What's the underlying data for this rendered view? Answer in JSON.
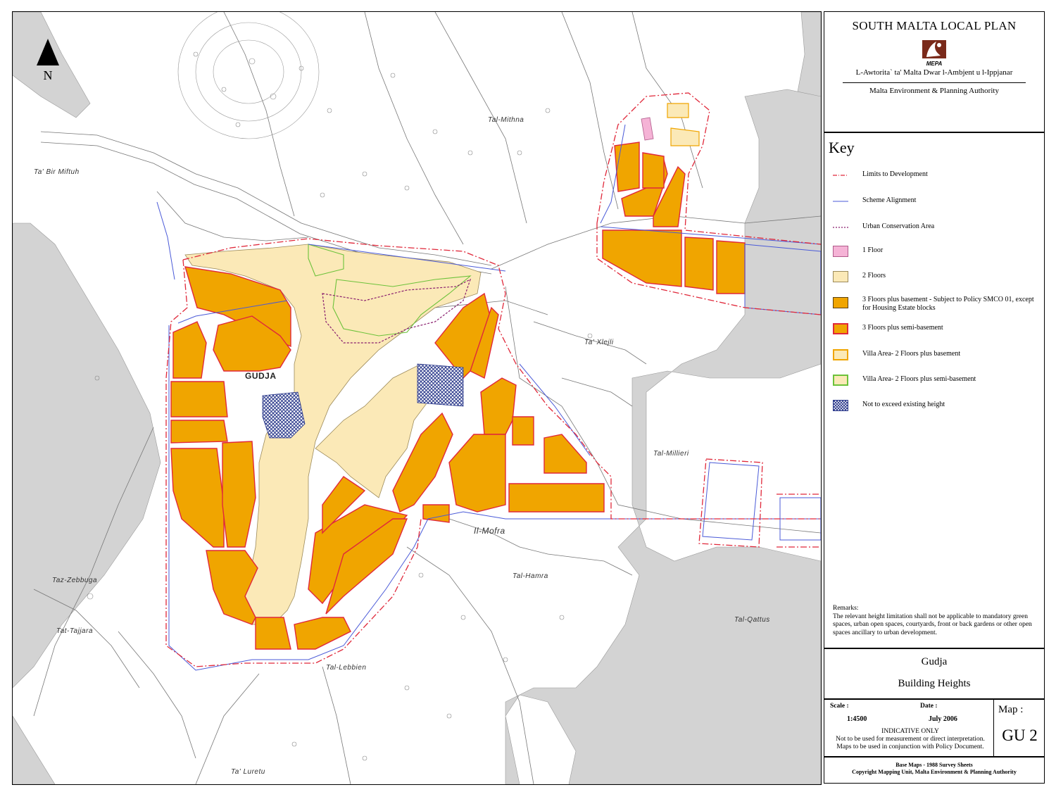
{
  "header": {
    "plan_title": "SOUTH MALTA LOCAL PLAN",
    "logo_text": "MEPA",
    "org_maltese": "L-Awtorita` ta' Malta Dwar l-Ambjent u l-Ippjanar",
    "org_english": "Malta Environment & Planning Authority"
  },
  "north_arrow": {
    "label": "N"
  },
  "place_names": [
    "Ta' Bir Miftuh",
    "Tal-Mithna",
    "Ta' Xlejli",
    "GUDJA",
    "Tal-Millieri",
    "Il-Mofra",
    "Tal-Hamra",
    "Taz-Zebbuga",
    "Tat-Tajjara",
    "Tal-Lebbien",
    "Tal-Qattus",
    "Ta' Luretu"
  ],
  "key": {
    "title": "Key",
    "items": [
      {
        "label": "Limits to Development",
        "kind": "dashdot",
        "color": "#e0283a"
      },
      {
        "label": "Scheme Alignment",
        "kind": "line",
        "color": "#4a5ad8"
      },
      {
        "label": "Urban Conservation Area",
        "kind": "dotted",
        "color": "#8a1f6e"
      },
      {
        "label": "1 Floor",
        "kind": "fill",
        "color": "#f5b3d6",
        "border": "#b05a8a"
      },
      {
        "label": "2 Floors",
        "kind": "fill",
        "color": "#fbe9b7",
        "border": "#9c8a5a"
      },
      {
        "label": "3 Floors plus basement - Subject to Policy SMCO 01, except for Housing Estate blocks",
        "kind": "fill",
        "color": "#f0a500",
        "border": "#5a4010"
      },
      {
        "label": "3 Floors plus semi-basement",
        "kind": "fill",
        "color": "#f0a500",
        "border": "#e0283a"
      },
      {
        "label": "Villa Area- 2 Floors plus basement",
        "kind": "fill",
        "color": "#fbe9b7",
        "border": "#f0a500"
      },
      {
        "label": "Villa Area- 2 Floors plus semi-basement",
        "kind": "fill",
        "color": "#fbe9b7",
        "border": "#6cc23a"
      },
      {
        "label": "Not to exceed existing height",
        "kind": "hatch",
        "color": "#2c3a8c",
        "border": "#2c3a8c"
      }
    ]
  },
  "remarks": {
    "heading": "Remarks:",
    "text": "The relevant height limitation shall not be applicable to mandatory green spaces, urban open spaces, courtyards, front or back gardens or other open spaces ancillary to urban development."
  },
  "map_name": {
    "locality": "Gudja",
    "subject": "Building Heights"
  },
  "info": {
    "scale_label": "Scale :",
    "scale_value": "1:4500",
    "date_label": "Date :",
    "date_value": "July 2006",
    "indicative_title": "INDICATIVE ONLY",
    "indicative_line1": "Not to be used for measurement or direct interpretation.",
    "indicative_line2": "Maps to be used in conjunction with Policy Document.",
    "map_label": "Map :",
    "map_value": "GU 2"
  },
  "credits": {
    "line1": "Base Maps - 1988 Survey Sheets",
    "line2": "Copyright Mapping Unit, Malta Environment & Planning Authority"
  },
  "colors": {
    "grey_area": "#d3d3d3",
    "map_lines": "#777777"
  }
}
